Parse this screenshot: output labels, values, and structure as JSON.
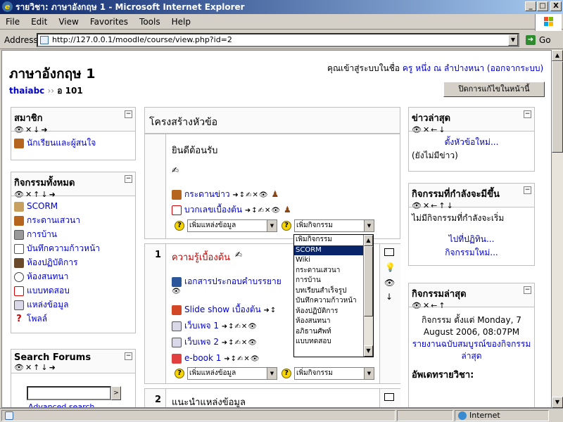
{
  "window": {
    "title": "รายวิชา: ภาษาอังกฤษ 1 - Microsoft Internet Explorer",
    "btn_min": "_",
    "btn_max": "□",
    "btn_close": "X"
  },
  "menu": [
    "File",
    "Edit",
    "View",
    "Favorites",
    "Tools",
    "Help"
  ],
  "address": {
    "label": "Address",
    "url": "http://127.0.0.1/moodle/course/view.php?id=2",
    "go": "Go"
  },
  "page": {
    "course_title": "ภาษาอังกฤษ 1",
    "login_text": "คุณเข้าสู่ระบบในชื่อ",
    "user_name": "ครู หนึ่ง ณ ลำปางหนา",
    "logout": "(ออกจากระบบ)",
    "breadcrumb_home": "thaiabc",
    "breadcrumb_sep": "››",
    "breadcrumb_course": "อ 101",
    "edit_button": "ปิดการแก้ไขในหน้านี้"
  },
  "left_blocks": {
    "members": {
      "title": "สมาชิก",
      "controls": "👁✕↓➜",
      "items": [
        "นักเรียนและผู้สนใจ"
      ]
    },
    "activities": {
      "title": "กิจกรรมทั้งหมด",
      "controls": "👁✕↑↓➜",
      "items": [
        "SCORM",
        "กระดานเสวนา",
        "การบ้าน",
        "บันทึกความก้าวหน้า",
        "ห้องปฏิบัติการ",
        "ห้องสนทนา",
        "แบบทดสอบ",
        "แหล่งข้อมูล",
        "โพลล์"
      ]
    },
    "search": {
      "title": "Search Forums",
      "controls": "👁✕↑↓➜",
      "advanced": "Advanced search"
    }
  },
  "center": {
    "header": "โครงสร้างหัวข้อ",
    "section0": {
      "welcome": "ยินดีต้อนรับ",
      "activities": [
        "กระดานข่าว",
        "บวกเลขเบื้องต้น"
      ],
      "add_resource": "เพิ่มแหล่งข้อมูล",
      "add_activity": "เพิ่มกิจกรรม"
    },
    "section1": {
      "num": "1",
      "title": "ความรู้เบื้องต้น",
      "activities": [
        "เอกสารประกอบคำบรรยาย",
        "Slide show เบื้องต้น",
        "เว็บเพจ 1",
        "เว็บเพจ 2",
        "e-book 1"
      ],
      "add_resource": "เพิ่มแหล่งข้อมูล",
      "add_activity": "เพิ่มกิจกรรม"
    },
    "section2": {
      "num": "2",
      "title": "แนะนำแหล่งข้อมูล"
    },
    "dropdown_options": [
      "เพิ่มกิจกรรม",
      "SCORM",
      "Wiki",
      "กระดานเสวนา",
      "การบ้าน",
      "บทเรียนสำเร็จรูป",
      "บันทึกความก้าวหน้า",
      "ห้องปฏิบัติการ",
      "ห้องสนทนา",
      "อภิธานศัพท์",
      "แบบทดสอบ"
    ],
    "dropdown_selected": "SCORM"
  },
  "right_blocks": {
    "news": {
      "title": "ข่าวล่าสุด",
      "controls": "👁✕←↓",
      "add": "ตั้งหัวข้อใหม่...",
      "none": "(ยังไม่มีข่าว)"
    },
    "upcoming": {
      "title": "กิจกรรมที่กำลังจะมีขึ้น",
      "controls": "👁✕←↑↓",
      "none": "ไม่มีกิจกรรมที่กำลังจะเริ่ม",
      "calendar": "ไปที่ปฏิทิน...",
      "new_event": "กิจกรรมใหม่..."
    },
    "recent": {
      "title": "กิจกรรมล่าสุด",
      "controls": "👁✕←↑",
      "since": "กิจกรรม ตั้งแต่ Monday, 7 August 2006, 08:07PM",
      "full_report": "รายงานฉบับสมบูรณ์ของกิจกรรมล่าสุด",
      "updates": "อัพเดทรายวิชา:"
    }
  },
  "status": {
    "zone": "Internet"
  },
  "colors": {
    "link": "#0000cc",
    "titlebar": "#0a246a",
    "section_title": "#cc0000"
  }
}
